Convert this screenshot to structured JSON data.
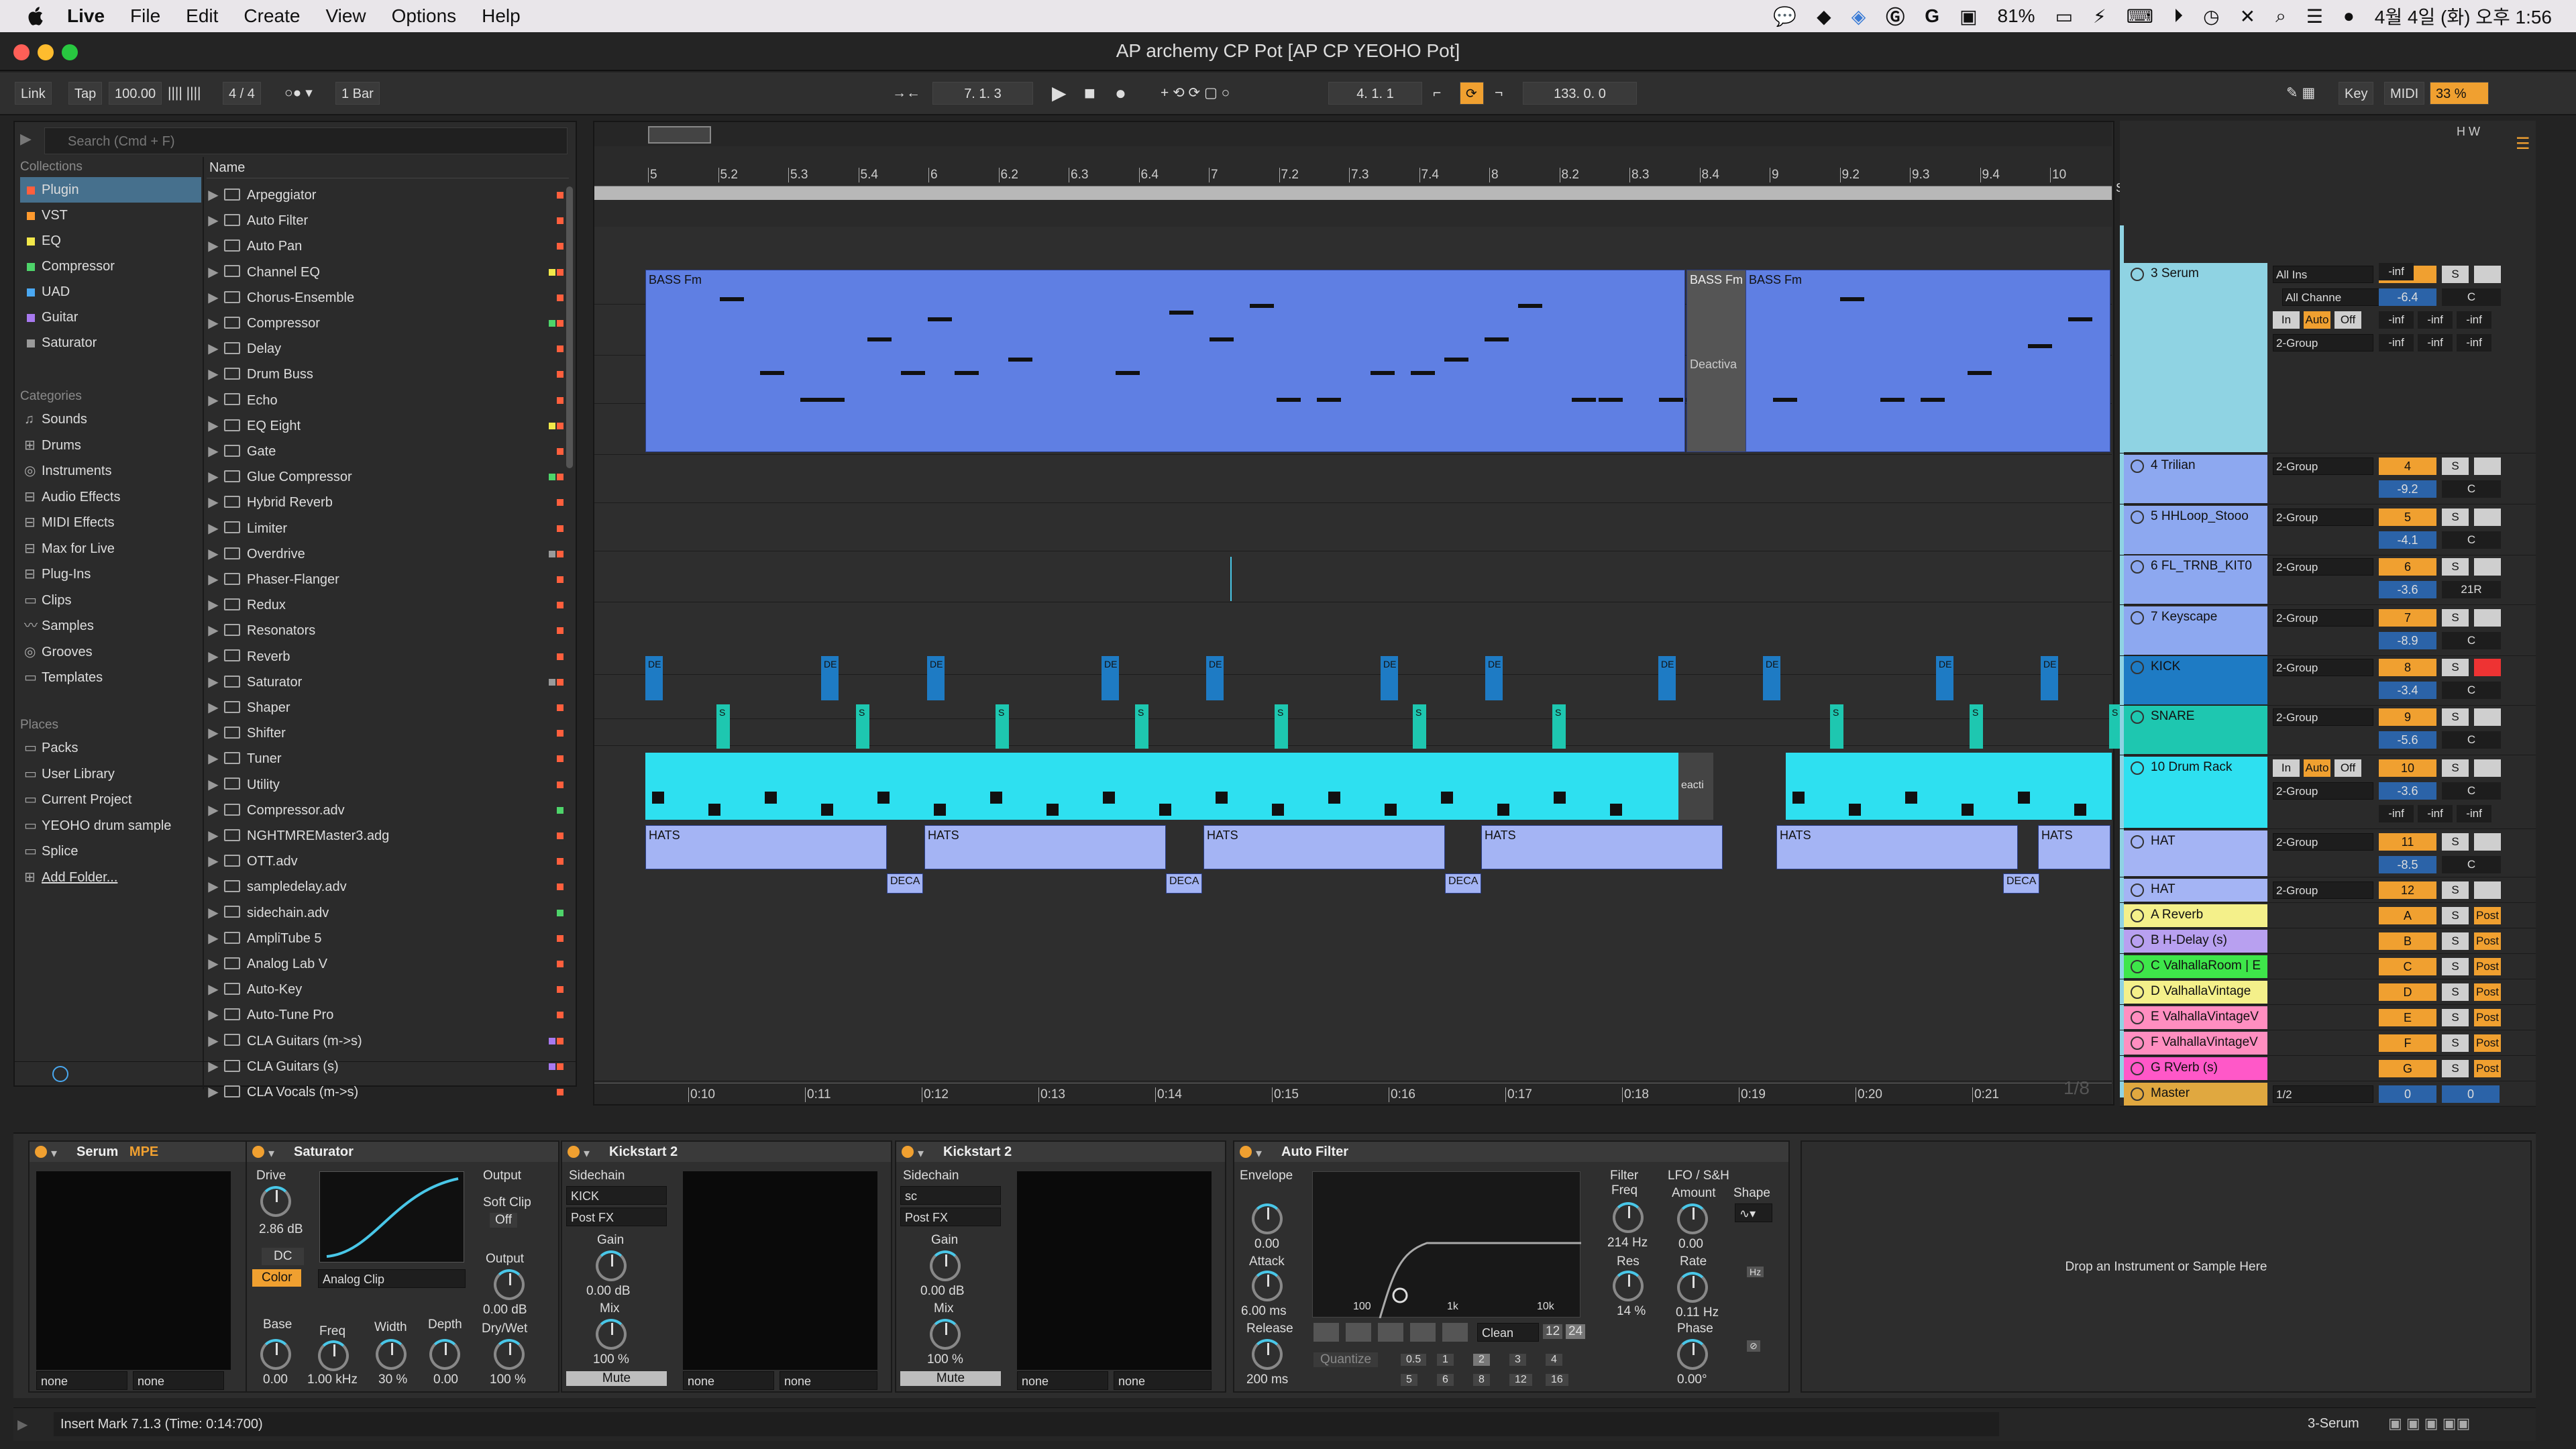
{
  "menubar": {
    "app_name": "Live",
    "items": [
      "File",
      "Edit",
      "Create",
      "View",
      "Options",
      "Help"
    ],
    "battery": "81%",
    "datetime": "4월 4일 (화) 오후 1:56"
  },
  "window": {
    "title": "AP archemy CP Pot  [AP CP YEOHO Pot]"
  },
  "toolbar": {
    "link": "Link",
    "tap": "Tap",
    "tempo": "100.00",
    "signature": "4 / 4",
    "quantize": "1 Bar",
    "position": "7.  1.  3",
    "loop_start": "4.  1.  1",
    "loop_length": "133.  0.  0",
    "key": "Key",
    "midi": "MIDI",
    "cpu": "33 %"
  },
  "browser": {
    "search_placeholder": "Search (Cmd + F)",
    "collections_header": "Collections",
    "collections": [
      {
        "label": "Plugin",
        "color": "#ff5f3d"
      },
      {
        "label": "VST",
        "color": "#ff9a2e"
      },
      {
        "label": "EQ",
        "color": "#f2e84a"
      },
      {
        "label": "Compressor",
        "color": "#4ed46a"
      },
      {
        "label": "UAD",
        "color": "#4aa8f2"
      },
      {
        "label": "Guitar",
        "color": "#a879f0"
      },
      {
        "label": "Saturator",
        "color": "#9a9a9a"
      }
    ],
    "categories_header": "Categories",
    "categories": [
      "Sounds",
      "Drums",
      "Instruments",
      "Audio Effects",
      "MIDI Effects",
      "Max for Live",
      "Plug-Ins",
      "Clips",
      "Samples",
      "Grooves",
      "Templates"
    ],
    "places_header": "Places",
    "places": [
      "Packs",
      "User Library",
      "Current Project",
      "YEOHO drum sample",
      "Splice",
      "Add Folder..."
    ],
    "name_header": "Name",
    "files": [
      {
        "name": "Arpeggiator",
        "tags": [
          "#ff5f3d"
        ]
      },
      {
        "name": "Auto Filter",
        "tags": [
          "#ff5f3d"
        ]
      },
      {
        "name": "Auto Pan",
        "tags": [
          "#ff5f3d"
        ]
      },
      {
        "name": "Channel EQ",
        "tags": [
          "#ff5f3d",
          "#f2e84a"
        ]
      },
      {
        "name": "Chorus-Ensemble",
        "tags": [
          "#ff5f3d"
        ]
      },
      {
        "name": "Compressor",
        "tags": [
          "#ff5f3d",
          "#4ed46a"
        ]
      },
      {
        "name": "Delay",
        "tags": [
          "#ff5f3d"
        ]
      },
      {
        "name": "Drum Buss",
        "tags": [
          "#ff5f3d"
        ]
      },
      {
        "name": "Echo",
        "tags": [
          "#ff5f3d"
        ]
      },
      {
        "name": "EQ Eight",
        "tags": [
          "#ff5f3d",
          "#f2e84a"
        ]
      },
      {
        "name": "Gate",
        "tags": [
          "#ff5f3d"
        ]
      },
      {
        "name": "Glue Compressor",
        "tags": [
          "#ff5f3d",
          "#4ed46a"
        ]
      },
      {
        "name": "Hybrid Reverb",
        "tags": [
          "#ff5f3d"
        ]
      },
      {
        "name": "Limiter",
        "tags": [
          "#ff5f3d"
        ]
      },
      {
        "name": "Overdrive",
        "tags": [
          "#ff5f3d",
          "#9a9a9a"
        ]
      },
      {
        "name": "Phaser-Flanger",
        "tags": [
          "#ff5f3d"
        ]
      },
      {
        "name": "Redux",
        "tags": [
          "#ff5f3d"
        ]
      },
      {
        "name": "Resonators",
        "tags": [
          "#ff5f3d"
        ]
      },
      {
        "name": "Reverb",
        "tags": [
          "#ff5f3d"
        ]
      },
      {
        "name": "Saturator",
        "tags": [
          "#ff5f3d",
          "#9a9a9a"
        ]
      },
      {
        "name": "Shaper",
        "tags": [
          "#ff5f3d"
        ]
      },
      {
        "name": "Shifter",
        "tags": [
          "#ff5f3d"
        ]
      },
      {
        "name": "Tuner",
        "tags": [
          "#ff5f3d"
        ]
      },
      {
        "name": "Utility",
        "tags": [
          "#ff5f3d"
        ]
      },
      {
        "name": "Compressor.adv",
        "tags": [
          "#4ed46a"
        ]
      },
      {
        "name": "NGHTMREMaster3.adg",
        "tags": [
          "#ff5f3d"
        ]
      },
      {
        "name": "OTT.adv",
        "tags": [
          "#ff5f3d"
        ]
      },
      {
        "name": "sampledelay.adv",
        "tags": [
          "#ff5f3d"
        ]
      },
      {
        "name": "sidechain.adv",
        "tags": [
          "#4ed46a"
        ]
      },
      {
        "name": "AmpliTube 5",
        "tags": [
          "#ff5f3d"
        ]
      },
      {
        "name": "Analog Lab V",
        "tags": [
          "#ff5f3d"
        ]
      },
      {
        "name": "Auto-Key",
        "tags": [
          "#ff5f3d"
        ]
      },
      {
        "name": "Auto-Tune Pro",
        "tags": [
          "#ff5f3d"
        ]
      },
      {
        "name": "CLA Guitars (m->s)",
        "tags": [
          "#ff5f3d",
          "#a879f0"
        ]
      },
      {
        "name": "CLA Guitars (s)",
        "tags": [
          "#ff5f3d",
          "#a879f0"
        ]
      },
      {
        "name": "CLA Vocals (m->s)",
        "tags": [
          "#ff5f3d"
        ]
      }
    ]
  },
  "arrangement": {
    "bar_ticks": [
      "5",
      "5.2",
      "5.3",
      "5.4",
      "6",
      "6.2",
      "6.3",
      "6.4",
      "7",
      "7.2",
      "7.3",
      "7.4",
      "8",
      "8.2",
      "8.3",
      "8.4",
      "9",
      "9.2",
      "9.3",
      "9.4",
      "10"
    ],
    "time_ticks": [
      "0:10",
      "0:11",
      "0:12",
      "0:13",
      "0:14",
      "0:15",
      "0:16",
      "0:17",
      "0:18",
      "0:19",
      "0:20",
      "0:21"
    ],
    "set_label": "Set",
    "bass_clip": "BASS Fm",
    "bass_clip_short": "BASS Fm",
    "bass_clip_tiny": "BAS",
    "deactivated": "Deactiva",
    "drum_clip_label": "eacti",
    "hats_clip": "HATS",
    "hats_short": "HATS",
    "deca_clip": "DECA",
    "kick_marker": "DE",
    "snare_marker": "S",
    "zoom_label": "1/8"
  },
  "mixer": {
    "tracks": [
      {
        "name": "3 Serum",
        "color": "#8fd3e3",
        "input": "All Ins",
        "channel": "All Channe",
        "monitor": [
          "In",
          "Auto",
          "Off"
        ],
        "output": "2-Group",
        "num": "3",
        "vol": "-6.4",
        "pan": "C",
        "inf": [
          "-inf",
          "-inf",
          "-inf",
          "-inf",
          "-inf",
          "-inf",
          "-inf"
        ]
      },
      {
        "name": "4 Trilian",
        "color": "#8da8f0",
        "output": "2-Group",
        "num": "4",
        "vol": "-9.2",
        "pan": "C"
      },
      {
        "name": "5 HHLoop_Stooo",
        "color": "#8da8f0",
        "output": "2-Group",
        "num": "5",
        "vol": "-4.1",
        "pan": "C"
      },
      {
        "name": "6 FL_TRNB_KIT0",
        "color": "#8da8f0",
        "output": "2-Group",
        "num": "6",
        "vol": "-3.6",
        "pan": "21R"
      },
      {
        "name": "7 Keyscape",
        "color": "#8da8f0",
        "output": "2-Group",
        "num": "7",
        "vol": "-8.9",
        "pan": "C"
      },
      {
        "name": "KICK",
        "color": "#1e7bc4",
        "output": "2-Group",
        "num": "8",
        "vol": "-3.4",
        "pan": "C"
      },
      {
        "name": "SNARE",
        "color": "#1ec7b0",
        "output": "2-Group",
        "num": "9",
        "vol": "-5.6",
        "pan": "C"
      },
      {
        "name": "10 Drum Rack",
        "color": "#2ee0f0",
        "output": "2-Group",
        "num": "10",
        "vol": "-3.6",
        "pan": "C",
        "monitor": [
          "In",
          "Auto",
          "Off"
        ],
        "inf": [
          "-inf",
          "-inf",
          "-inf"
        ]
      },
      {
        "name": "HAT",
        "color": "#a4b4f4",
        "output": "2-Group",
        "num": "11",
        "vol": "-8.5",
        "pan": "C"
      },
      {
        "name": "HAT",
        "color": "#a4b4f4",
        "output": "2-Group",
        "num": "12"
      }
    ],
    "returns": [
      {
        "name": "A Reverb",
        "color": "#f4f08a",
        "letter": "A"
      },
      {
        "name": "B H-Delay (s)",
        "color": "#b8a0f0",
        "letter": "B"
      },
      {
        "name": "C ValhallaRoom | E",
        "color": "#3ee64a",
        "letter": "C"
      },
      {
        "name": "D ValhallaVintage",
        "color": "#f4f08a",
        "letter": "D"
      },
      {
        "name": "E ValhallaVintageV",
        "color": "#ff8ec0",
        "letter": "E"
      },
      {
        "name": "F ValhallaVintageV",
        "color": "#ff8ec0",
        "letter": "F"
      },
      {
        "name": "G RVerb (s)",
        "color": "#ff58c8",
        "letter": "G"
      }
    ],
    "master": {
      "name": "Master",
      "color": "#e0a840",
      "output": "1/2",
      "num": "0",
      "vol": "0"
    },
    "solo": "S",
    "post": "Post"
  },
  "devices": {
    "serum": {
      "title": "Serum",
      "mpe": "MPE",
      "sel1": "none",
      "sel2": "none"
    },
    "saturator": {
      "title": "Saturator",
      "drive_label": "Drive",
      "drive": "2.86 dB",
      "dc": "DC",
      "color": "Color",
      "mode": "Analog Clip",
      "output_label": "Output",
      "softclip": "Soft Clip",
      "softclip_state": "Off",
      "output_knob_label": "Output",
      "output_value": "0.00 dB",
      "drywet_label": "Dry/Wet",
      "drywet": "100 %",
      "base_label": "Base",
      "base": "0.00",
      "freq_label": "Freq",
      "freq": "1.00 kHz",
      "width_label": "Width",
      "width": "30 %",
      "depth_label": "Depth",
      "depth": "0.00"
    },
    "kick1": {
      "title": "Kickstart 2",
      "sidechain": "Sidechain",
      "source": "KICK",
      "tap": "Post FX",
      "gain_label": "Gain",
      "gain": "0.00 dB",
      "mix_label": "Mix",
      "mix": "100 %",
      "mute": "Mute",
      "sel1": "none",
      "sel2": "none"
    },
    "kick2": {
      "title": "Kickstart 2",
      "sidechain": "Sidechain",
      "source": "sc",
      "tap": "Post FX",
      "gain_label": "Gain",
      "gain": "0.00 dB",
      "mix_label": "Mix",
      "mix": "100 %",
      "mute": "Mute",
      "sel1": "none",
      "sel2": "none"
    },
    "autofilter": {
      "title": "Auto Filter",
      "envelope": "Envelope",
      "env_amt": "0.00",
      "attack_label": "Attack",
      "attack": "6.00 ms",
      "release_label": "Release",
      "release": "200 ms",
      "filter_label": "Filter",
      "freq_label": "Freq",
      "freq": "214 Hz",
      "res_label": "Res",
      "res": "14 %",
      "lfo": "LFO / S&H",
      "amount_label": "Amount",
      "amount": "0.00",
      "rate_label": "Rate",
      "rate": "0.11 Hz",
      "phase_label": "Phase",
      "phase": "0.00°",
      "shape_label": "Shape",
      "clean": "Clean",
      "q12": "12",
      "q24": "24",
      "quantize": "Quantize",
      "grid": [
        "0.5",
        "1",
        "2",
        "3",
        "4",
        "5",
        "6",
        "8",
        "12",
        "16"
      ],
      "axis": [
        "100",
        "1k",
        "10k"
      ]
    },
    "drop": "Drop an Instrument or Sample Here"
  },
  "status": {
    "text": "Insert Mark 7.1.3 (Time: 0:14:700)",
    "track": "3-Serum"
  }
}
